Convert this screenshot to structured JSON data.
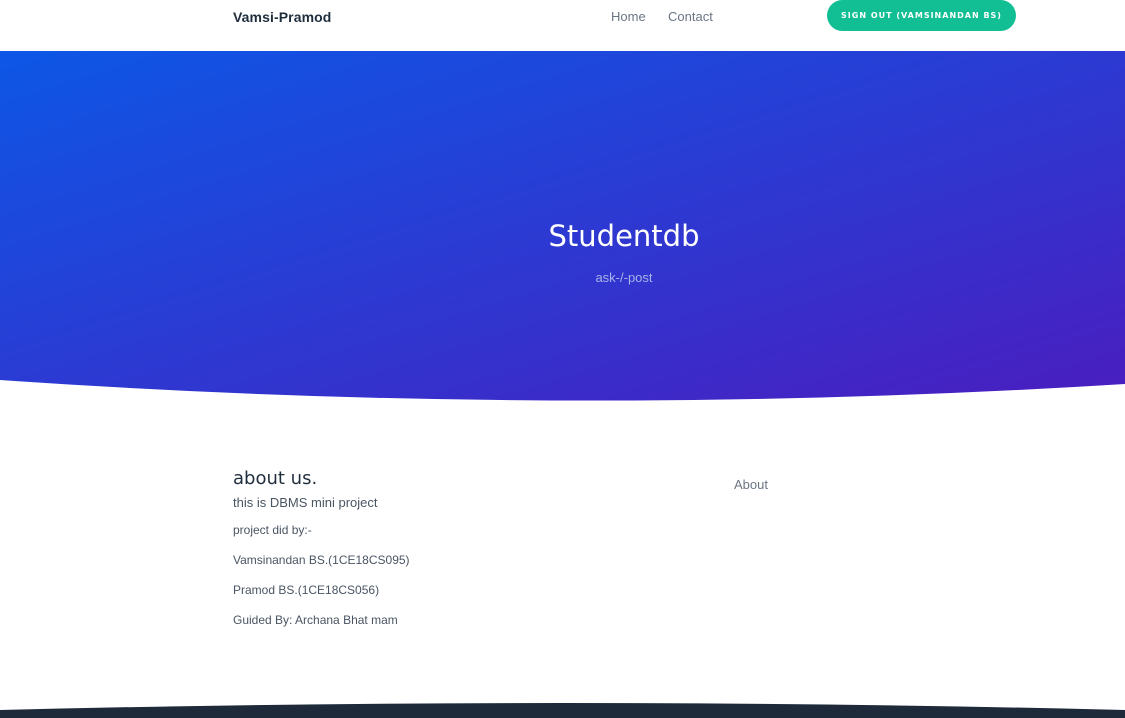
{
  "nav": {
    "brand": "Vamsi-Pramod",
    "links": [
      {
        "label": "Home"
      },
      {
        "label": "Contact"
      },
      {
        "label": "About"
      }
    ],
    "signout_label": "SIGN OUT (VAMSINANDAN BS)"
  },
  "hero": {
    "title": "Studentdb",
    "subtitle": "ask-/-post",
    "gradient_start": "#0d57e6",
    "gradient_end": "#4a1dbf"
  },
  "about": {
    "heading": "about us.",
    "line1": "this is DBMS mini project",
    "lines": [
      "project did by:-",
      "Vamsinandan BS.(1CE18CS095)",
      "Pramod BS.(1CE18CS056)",
      "Guided By: Archana Bhat mam"
    ]
  },
  "colors": {
    "accent": "#12bf95",
    "footer": "#1e2a3a"
  }
}
